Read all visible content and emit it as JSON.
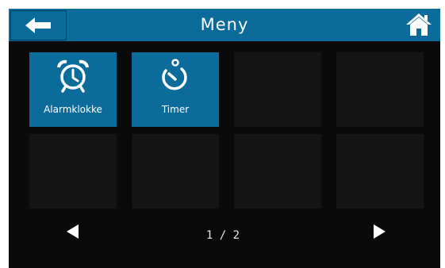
{
  "header": {
    "title": "Meny",
    "back_icon": "arrow-left-icon",
    "home_icon": "home-icon"
  },
  "grid": {
    "tiles": [
      {
        "label": "Alarmklokke",
        "icon": "alarm-clock-icon"
      },
      {
        "label": "Timer",
        "icon": "stopwatch-icon"
      }
    ]
  },
  "pager": {
    "indicator": "1 / 2",
    "prev_icon": "triangle-left-icon",
    "next_icon": "triangle-right-icon"
  },
  "colors": {
    "accent": "#0b6b9a",
    "background": "#0a0a0a",
    "empty_tile": "#141414"
  }
}
